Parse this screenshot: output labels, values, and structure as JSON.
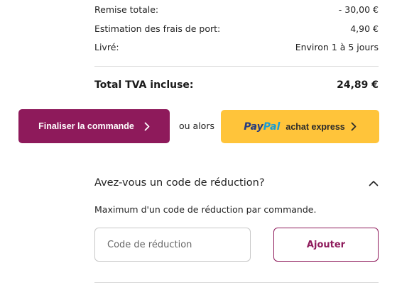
{
  "summary": {
    "discount_label": "Remise totale:",
    "discount_value": "- 30,00 €",
    "shipping_label": "Estimation des frais de port:",
    "shipping_value": "4,90 €",
    "delivery_label": "Livré:",
    "delivery_value": "Environ 1 à 5 jours"
  },
  "total": {
    "label": "Total TVA incluse:",
    "value": "24,89 €"
  },
  "actions": {
    "checkout_label": "Finaliser la commande",
    "or_text": "ou alors",
    "paypal_logo_pay": "Pay",
    "paypal_logo_pal": "Pal",
    "paypal_label": "achat express"
  },
  "discount_code": {
    "title": "Avez-vous un code de réduction?",
    "note": "Maximum d'un code de réduction par commande.",
    "input_placeholder": "Code de réduction",
    "input_value": "",
    "apply_label": "Ajouter",
    "expanded": true
  },
  "colors": {
    "brand": "#8e1a5b",
    "paypal_button": "#ffc43a",
    "paypal_dark": "#253b80",
    "paypal_light": "#179bd7"
  },
  "icons": {
    "checkout_chevron": "chevron-right-icon",
    "paypal_chevron": "chevron-right-icon",
    "collapse_chevron": "chevron-up-icon"
  }
}
